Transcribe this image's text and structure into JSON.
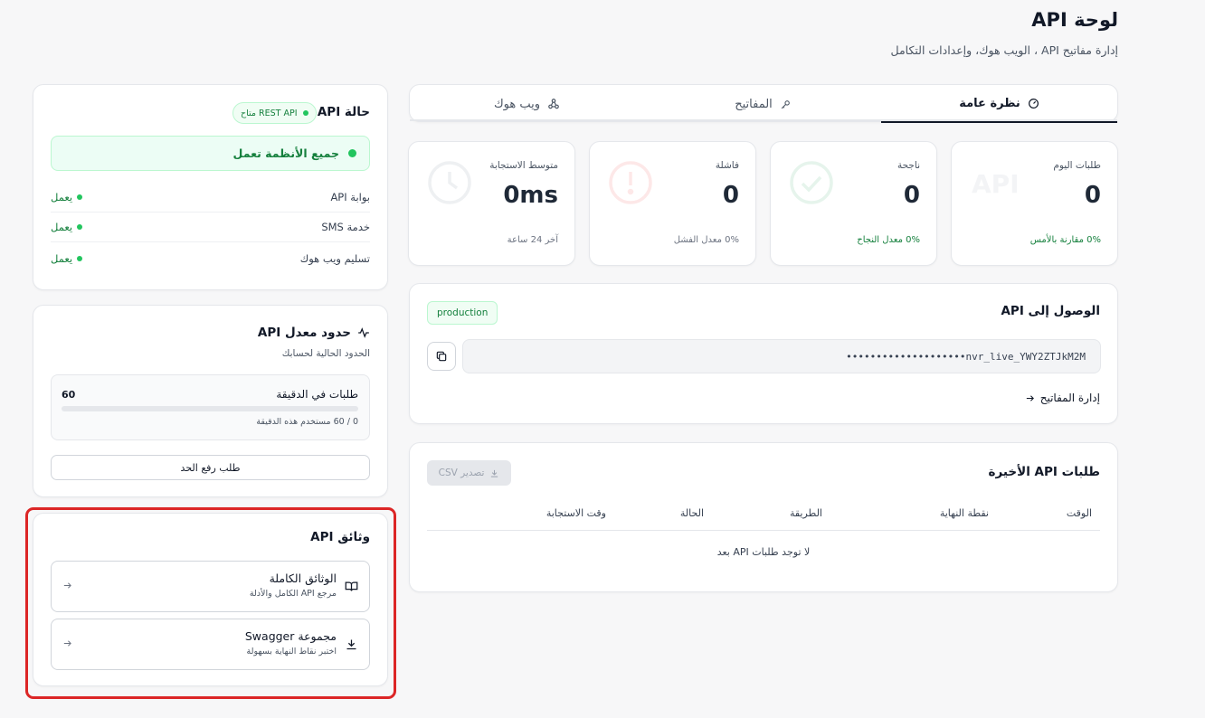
{
  "header": {
    "title": "لوحة API",
    "subtitle": "إدارة مفاتيح API ، الويب هوك، وإعدادات التكامل"
  },
  "tabs": [
    {
      "label": "نظرة عامة",
      "icon": "gauge-icon",
      "active": true
    },
    {
      "label": "المفاتيح",
      "icon": "key-icon",
      "active": false
    },
    {
      "label": "ويب هوك",
      "icon": "webhook-icon",
      "active": false
    }
  ],
  "stats": [
    {
      "label": "طلبات اليوم",
      "value": "0",
      "foot": "0% مقارنة بالأمس",
      "foot_color": "#15803d",
      "icon": "api-text-icon"
    },
    {
      "label": "ناجحة",
      "value": "0",
      "foot": "0% معدل النجاح",
      "foot_color": "#15803d",
      "icon": "check-circle-icon"
    },
    {
      "label": "فاشلة",
      "value": "0",
      "foot": "0% معدل الفشل",
      "foot_color": "#6b7280",
      "icon": "alert-circle-icon"
    },
    {
      "label": "متوسط الاستجابة",
      "value": "0ms",
      "foot": "آخر 24 ساعة",
      "foot_color": "#6b7280",
      "icon": "clock-icon"
    }
  ],
  "stat_watermark": "API",
  "access": {
    "title": "الوصول إلى API",
    "env_badge": "production",
    "key_masked": "••••••••••••••••••••nvr_live_YWY2ZTJkM2M",
    "manage_link": "إدارة المفاتيح"
  },
  "recent": {
    "title": "طلبات API الأخيرة",
    "export_label": "تصدير CSV",
    "columns": [
      "الوقت",
      "نقطة النهاية",
      "الطريقة",
      "الحالة",
      "وقت الاستجابة"
    ],
    "empty_text": "لا توجد طلبات API بعد"
  },
  "status": {
    "title": "حالة API",
    "pill": "REST API متاح",
    "banner": "جميع الأنظمة تعمل",
    "services": [
      {
        "name": "بوابة API",
        "state": "يعمل"
      },
      {
        "name": "خدمة SMS",
        "state": "يعمل"
      },
      {
        "name": "تسليم ويب هوك",
        "state": "يعمل"
      }
    ]
  },
  "limits": {
    "title": "حدود معدل API",
    "subtitle": "الحدود الحالية لحسابك",
    "per_minute_label": "طلبات في الدقيقة",
    "per_minute_value": "60",
    "usage_fraction": 0,
    "usage_text": "0 / 60 مستخدم هذه الدقيقة",
    "request_button": "طلب رفع الحد"
  },
  "docs": {
    "title": "وثائق API",
    "items": [
      {
        "title": "الوثائق الكاملة",
        "desc": "مرجع API الكامل والأدلة",
        "icon": "book-icon"
      },
      {
        "title": "مجموعة Swagger",
        "desc": "اختبر نقاط النهاية بسهولة",
        "icon": "download-icon"
      }
    ]
  }
}
